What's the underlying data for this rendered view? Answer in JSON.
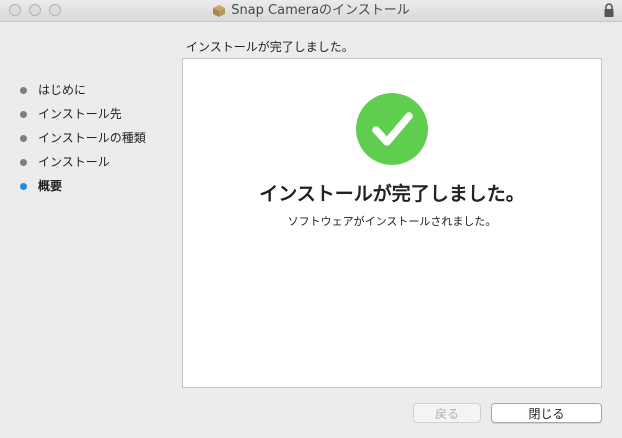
{
  "window": {
    "title": "Snap Cameraのインストール"
  },
  "header": {
    "text": "インストールが完了しました。"
  },
  "sidebar": {
    "steps": [
      {
        "label": "はじめに",
        "active": false
      },
      {
        "label": "インストール先",
        "active": false
      },
      {
        "label": "インストールの種類",
        "active": false
      },
      {
        "label": "インストール",
        "active": false
      },
      {
        "label": "概要",
        "active": true
      }
    ]
  },
  "main": {
    "title": "インストールが完了しました。",
    "subtitle": "ソフトウェアがインストールされました。"
  },
  "buttons": {
    "back_label": "戻る",
    "close_label": "閉じる"
  },
  "colors": {
    "success_green": "#5fce4f",
    "active_step_blue": "#1d8ce0",
    "inactive_step_gray": "#7d7d7d"
  },
  "icons": {
    "title": "package-icon",
    "lock": "lock-icon",
    "status": "checkmark-icon"
  }
}
